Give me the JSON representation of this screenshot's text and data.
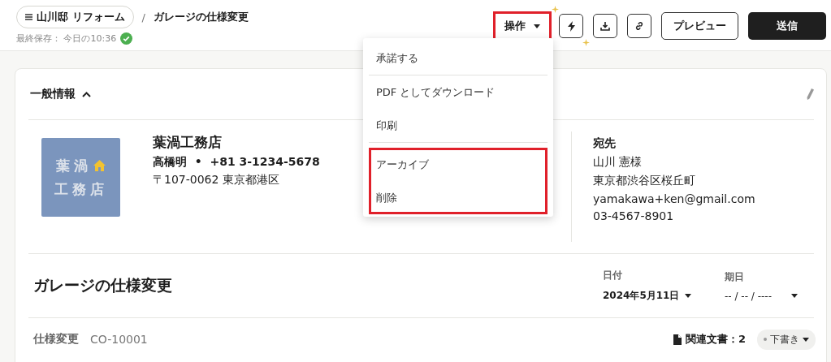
{
  "breadcrumb": {
    "project": "山川邸 リフォーム",
    "separator": "/",
    "current": "ガレージの仕様変更"
  },
  "save_status": {
    "label": "最終保存： 今日の10:36",
    "saved": true
  },
  "toolbar": {
    "actions": {
      "label": "操作",
      "highlighted": true,
      "expanded": true
    },
    "preview": "プレビュー",
    "send": "送信"
  },
  "actions_menu": [
    {
      "items": [
        "承諾する"
      ],
      "highlighted": false
    },
    {
      "items": [
        "PDF としてダウンロード",
        "印刷"
      ],
      "highlighted": false
    },
    {
      "items": [
        "アーカイブ",
        "削除"
      ],
      "highlighted": true
    }
  ],
  "section": {
    "title": "一般情報",
    "expanded": true
  },
  "sender": {
    "logo_lines": [
      "葉渦",
      "工務店"
    ],
    "company": "葉渦工務店",
    "contact": "高橋明",
    "contact_separator": "•",
    "phone": "+81 3-1234-5678",
    "address": "〒107-0062 東京都港区"
  },
  "recipient": {
    "heading": "宛先",
    "name": "山川 憲様",
    "address": "東京都渋谷区桜丘町",
    "email": "yamakawa+ken@gmail.com",
    "phone": "03-4567-8901"
  },
  "document": {
    "title": "ガレージの仕様変更",
    "date": {
      "label": "日付",
      "value": "2024年5月11日"
    },
    "due": {
      "label": "期日",
      "value": "-- / -- / ----"
    }
  },
  "footer": {
    "type": "仕様変更",
    "number": "CO-10001",
    "related": "関連文書：2",
    "status": "下書き"
  }
}
